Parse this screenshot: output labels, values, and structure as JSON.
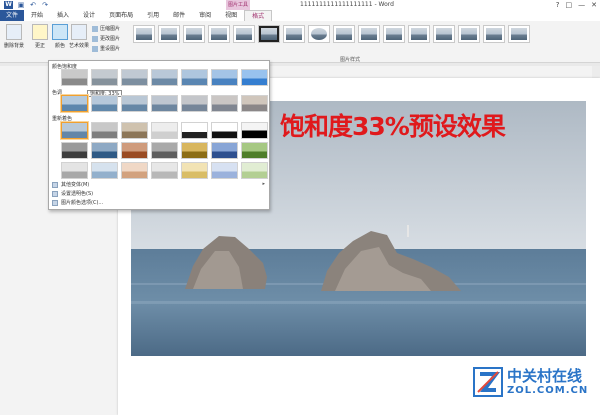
{
  "window": {
    "title": "1111111111111111111 - Word",
    "context_tab": "图片工具",
    "controls": [
      "?",
      "□",
      "—",
      "✕"
    ]
  },
  "tabs": [
    "文件",
    "开始",
    "插入",
    "设计",
    "页面布局",
    "引用",
    "邮件",
    "审阅",
    "视图",
    "格式"
  ],
  "ribbon": {
    "remove_bg": "删除背景",
    "corrections": "更正",
    "color": "颜色",
    "artistic": "艺术效果",
    "compress": "压缩图片",
    "change": "更改图片",
    "reset": "重设图片",
    "styles_group": "图片样式"
  },
  "panel": {
    "saturation_heading": "颜色饱和度",
    "tone_heading": "色调",
    "recolor_heading": "重新着色",
    "tooltip": "饱和度: 33%",
    "more_variations": "其他变体(M)",
    "set_transparent": "设置透明色(S)",
    "color_options": "图片颜色选项(C)..."
  },
  "document": {
    "overlay_text": "饱和度33%预设效果"
  },
  "watermark": {
    "cn": "中关村在线",
    "en": "ZOL.COM.CN"
  },
  "colors": {
    "word_blue": "#2b579a",
    "context_pink": "#a0306e",
    "overlay_red": "#e0191c",
    "watermark_blue": "#2a74c7"
  }
}
